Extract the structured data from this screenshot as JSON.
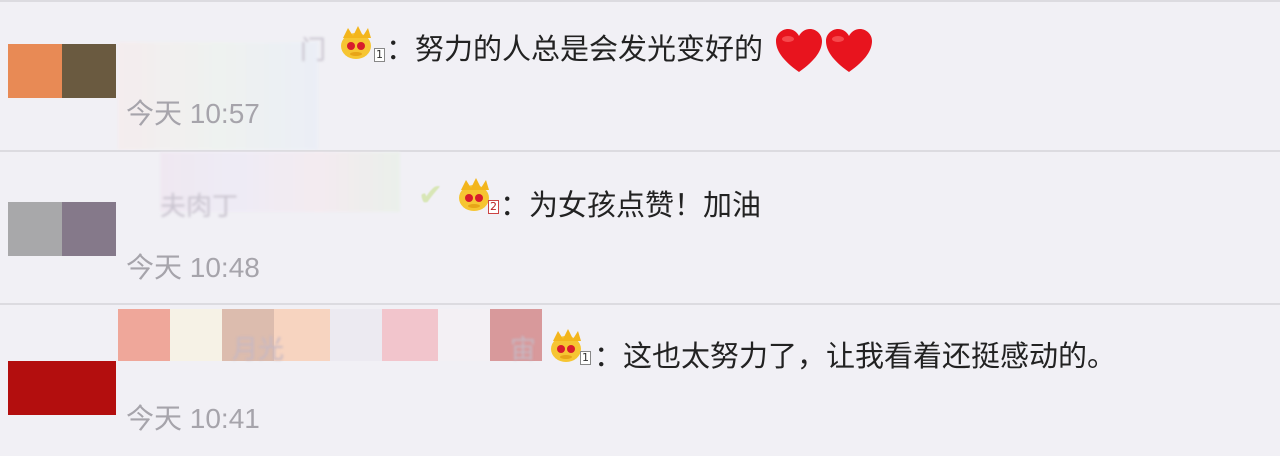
{
  "comments": [
    {
      "text": "：努力的人总是会发光变好的",
      "time": "今天 10:57",
      "badge": "1",
      "hearts": [
        "heart-icon",
        "heart-icon"
      ],
      "avatar_colors": [
        "#e88a55",
        "#6a5a40"
      ],
      "obscured_name": "门"
    },
    {
      "text": "：为女孩点赞！加油",
      "time": "今天 10:48",
      "badge": "2",
      "avatar_colors": [
        "#a8a8aa",
        "#85798a"
      ],
      "obscured_name": "夫肉丁"
    },
    {
      "text": "：这也太努力了，让我看着还挺感动的。",
      "time": "今天 10:41",
      "badge": "1",
      "avatar_colors": [
        "#b30e0e",
        "#b30e0e"
      ],
      "obscured_name": "月光",
      "obscured_name_tail": "宙"
    }
  ],
  "icons": {
    "crown": "crown-badge-icon",
    "heart": "heart-icon",
    "check": "check-icon"
  },
  "colors": {
    "background": "#f1f0f5",
    "divider": "#dcdbe0",
    "time_text": "#a6a4ab",
    "comment_text": "#222222",
    "heart_red": "#e8141e"
  }
}
